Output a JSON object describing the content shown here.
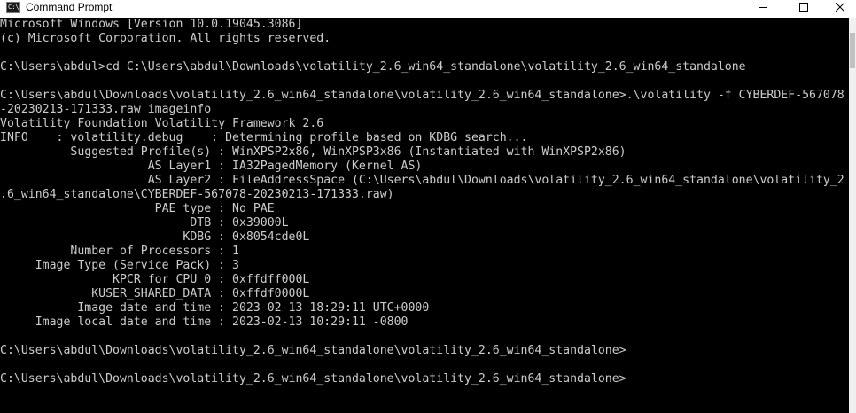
{
  "window": {
    "title": "Command Prompt",
    "icon_glyph": "C:\\",
    "icon_name": "console-icon"
  },
  "caption_buttons": {
    "minimize": "minimize-icon",
    "maximize": "maximize-icon",
    "close": "close-icon"
  },
  "colors": {
    "console_background": "#000000",
    "console_text": "#cccccc"
  },
  "console": {
    "lines": [
      "Microsoft Windows [Version 10.0.19045.3086]",
      "(c) Microsoft Corporation. All rights reserved.",
      "",
      "C:\\Users\\abdul>cd C:\\Users\\abdul\\Downloads\\volatility_2.6_win64_standalone\\volatility_2.6_win64_standalone",
      "",
      "C:\\Users\\abdul\\Downloads\\volatility_2.6_win64_standalone\\volatility_2.6_win64_standalone>.\\volatility -f CYBERDEF-567078",
      "-20230213-171333.raw imageinfo",
      "Volatility Foundation Volatility Framework 2.6",
      "INFO    : volatility.debug    : Determining profile based on KDBG search...",
      "          Suggested Profile(s) : WinXPSP2x86, WinXPSP3x86 (Instantiated with WinXPSP2x86)",
      "                     AS Layer1 : IA32PagedMemory (Kernel AS)",
      "                     AS Layer2 : FileAddressSpace (C:\\Users\\abdul\\Downloads\\volatility_2.6_win64_standalone\\volatility_2",
      ".6_win64_standalone\\CYBERDEF-567078-20230213-171333.raw)",
      "                      PAE type : No PAE",
      "                           DTB : 0x39000L",
      "                          KDBG : 0x8054cde0L",
      "          Number of Processors : 1",
      "     Image Type (Service Pack) : 3",
      "                KPCR for CPU 0 : 0xffdff000L",
      "             KUSER_SHARED_DATA : 0xffdf0000L",
      "           Image date and time : 2023-02-13 18:29:11 UTC+0000",
      "     Image local date and time : 2023-02-13 10:29:11 -0800",
      "",
      "C:\\Users\\abdul\\Downloads\\volatility_2.6_win64_standalone\\volatility_2.6_win64_standalone>",
      "",
      "C:\\Users\\abdul\\Downloads\\volatility_2.6_win64_standalone\\volatility_2.6_win64_standalone>"
    ]
  }
}
